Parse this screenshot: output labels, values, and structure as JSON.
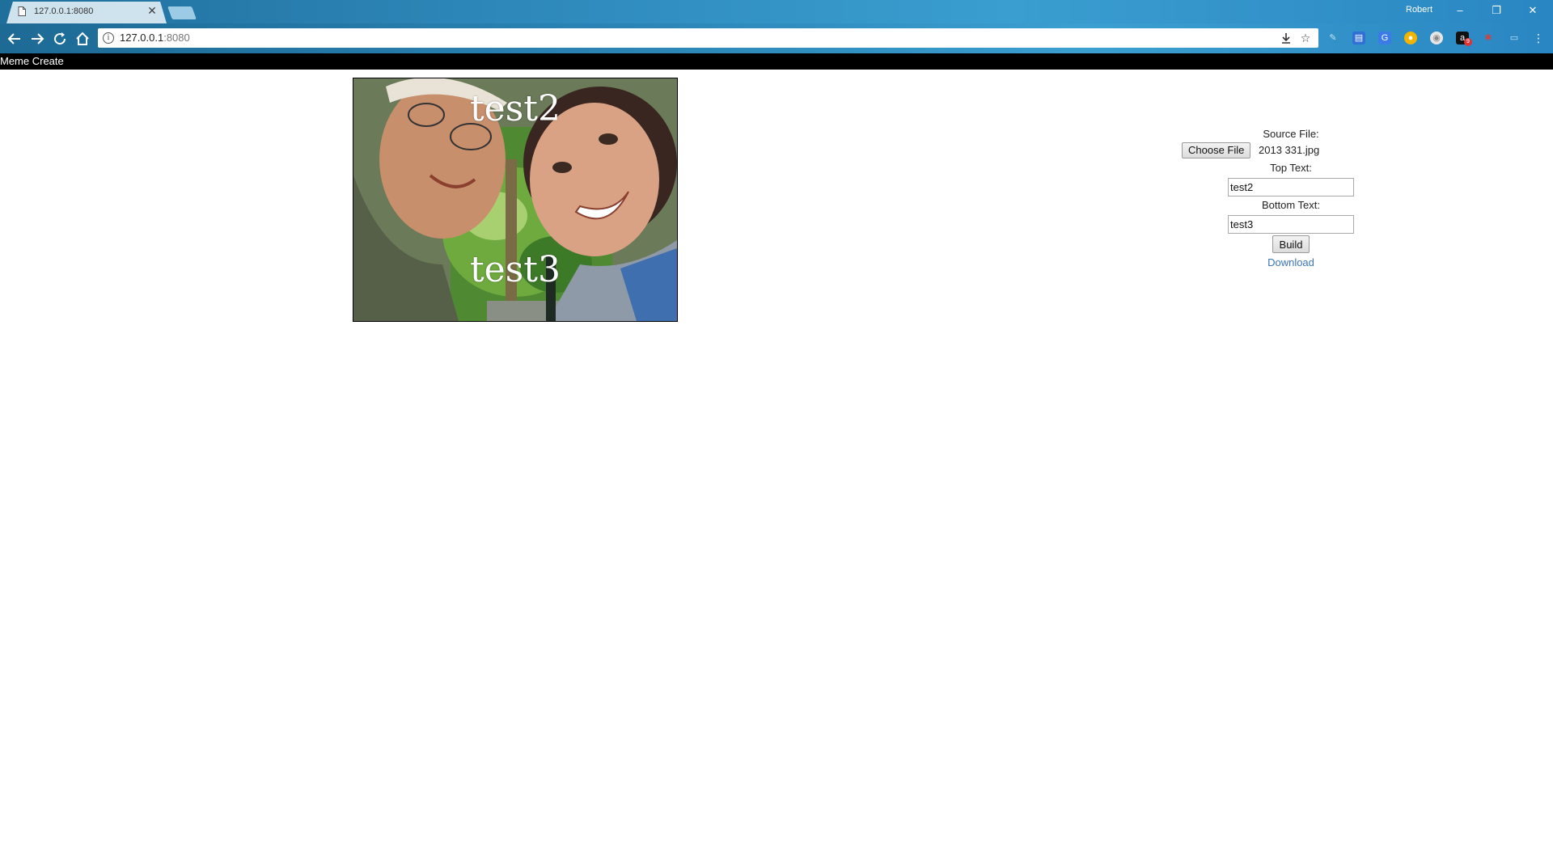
{
  "browser": {
    "tab_title": "127.0.0.1:8080",
    "profile_name": "Robert",
    "url_host": "127.0.0.1",
    "url_port": ":8080",
    "tab_close_glyph": "✕",
    "icons": {
      "back": "back-arrow-icon",
      "forward": "forward-arrow-icon",
      "reload": "reload-icon",
      "home": "home-icon",
      "info": "info-icon",
      "download": "download-icon",
      "bookmark": "star-icon",
      "menu": "more-vert-icon"
    },
    "extension_badge": "9"
  },
  "app": {
    "title": "Meme Create"
  },
  "meme": {
    "top_text": "test2",
    "bottom_text": "test3"
  },
  "form": {
    "source_label": "Source File:",
    "choose_label": "Choose File",
    "file_name": "2013 331.jpg",
    "top_label": "Top Text:",
    "top_value": "test2",
    "bottom_label": "Bottom Text:",
    "bottom_value": "test3",
    "build_label": "Build",
    "download_label": "Download"
  },
  "colors": {
    "appbar": "#000000",
    "link": "#3a76b8",
    "chrome": "#2a86c2"
  }
}
